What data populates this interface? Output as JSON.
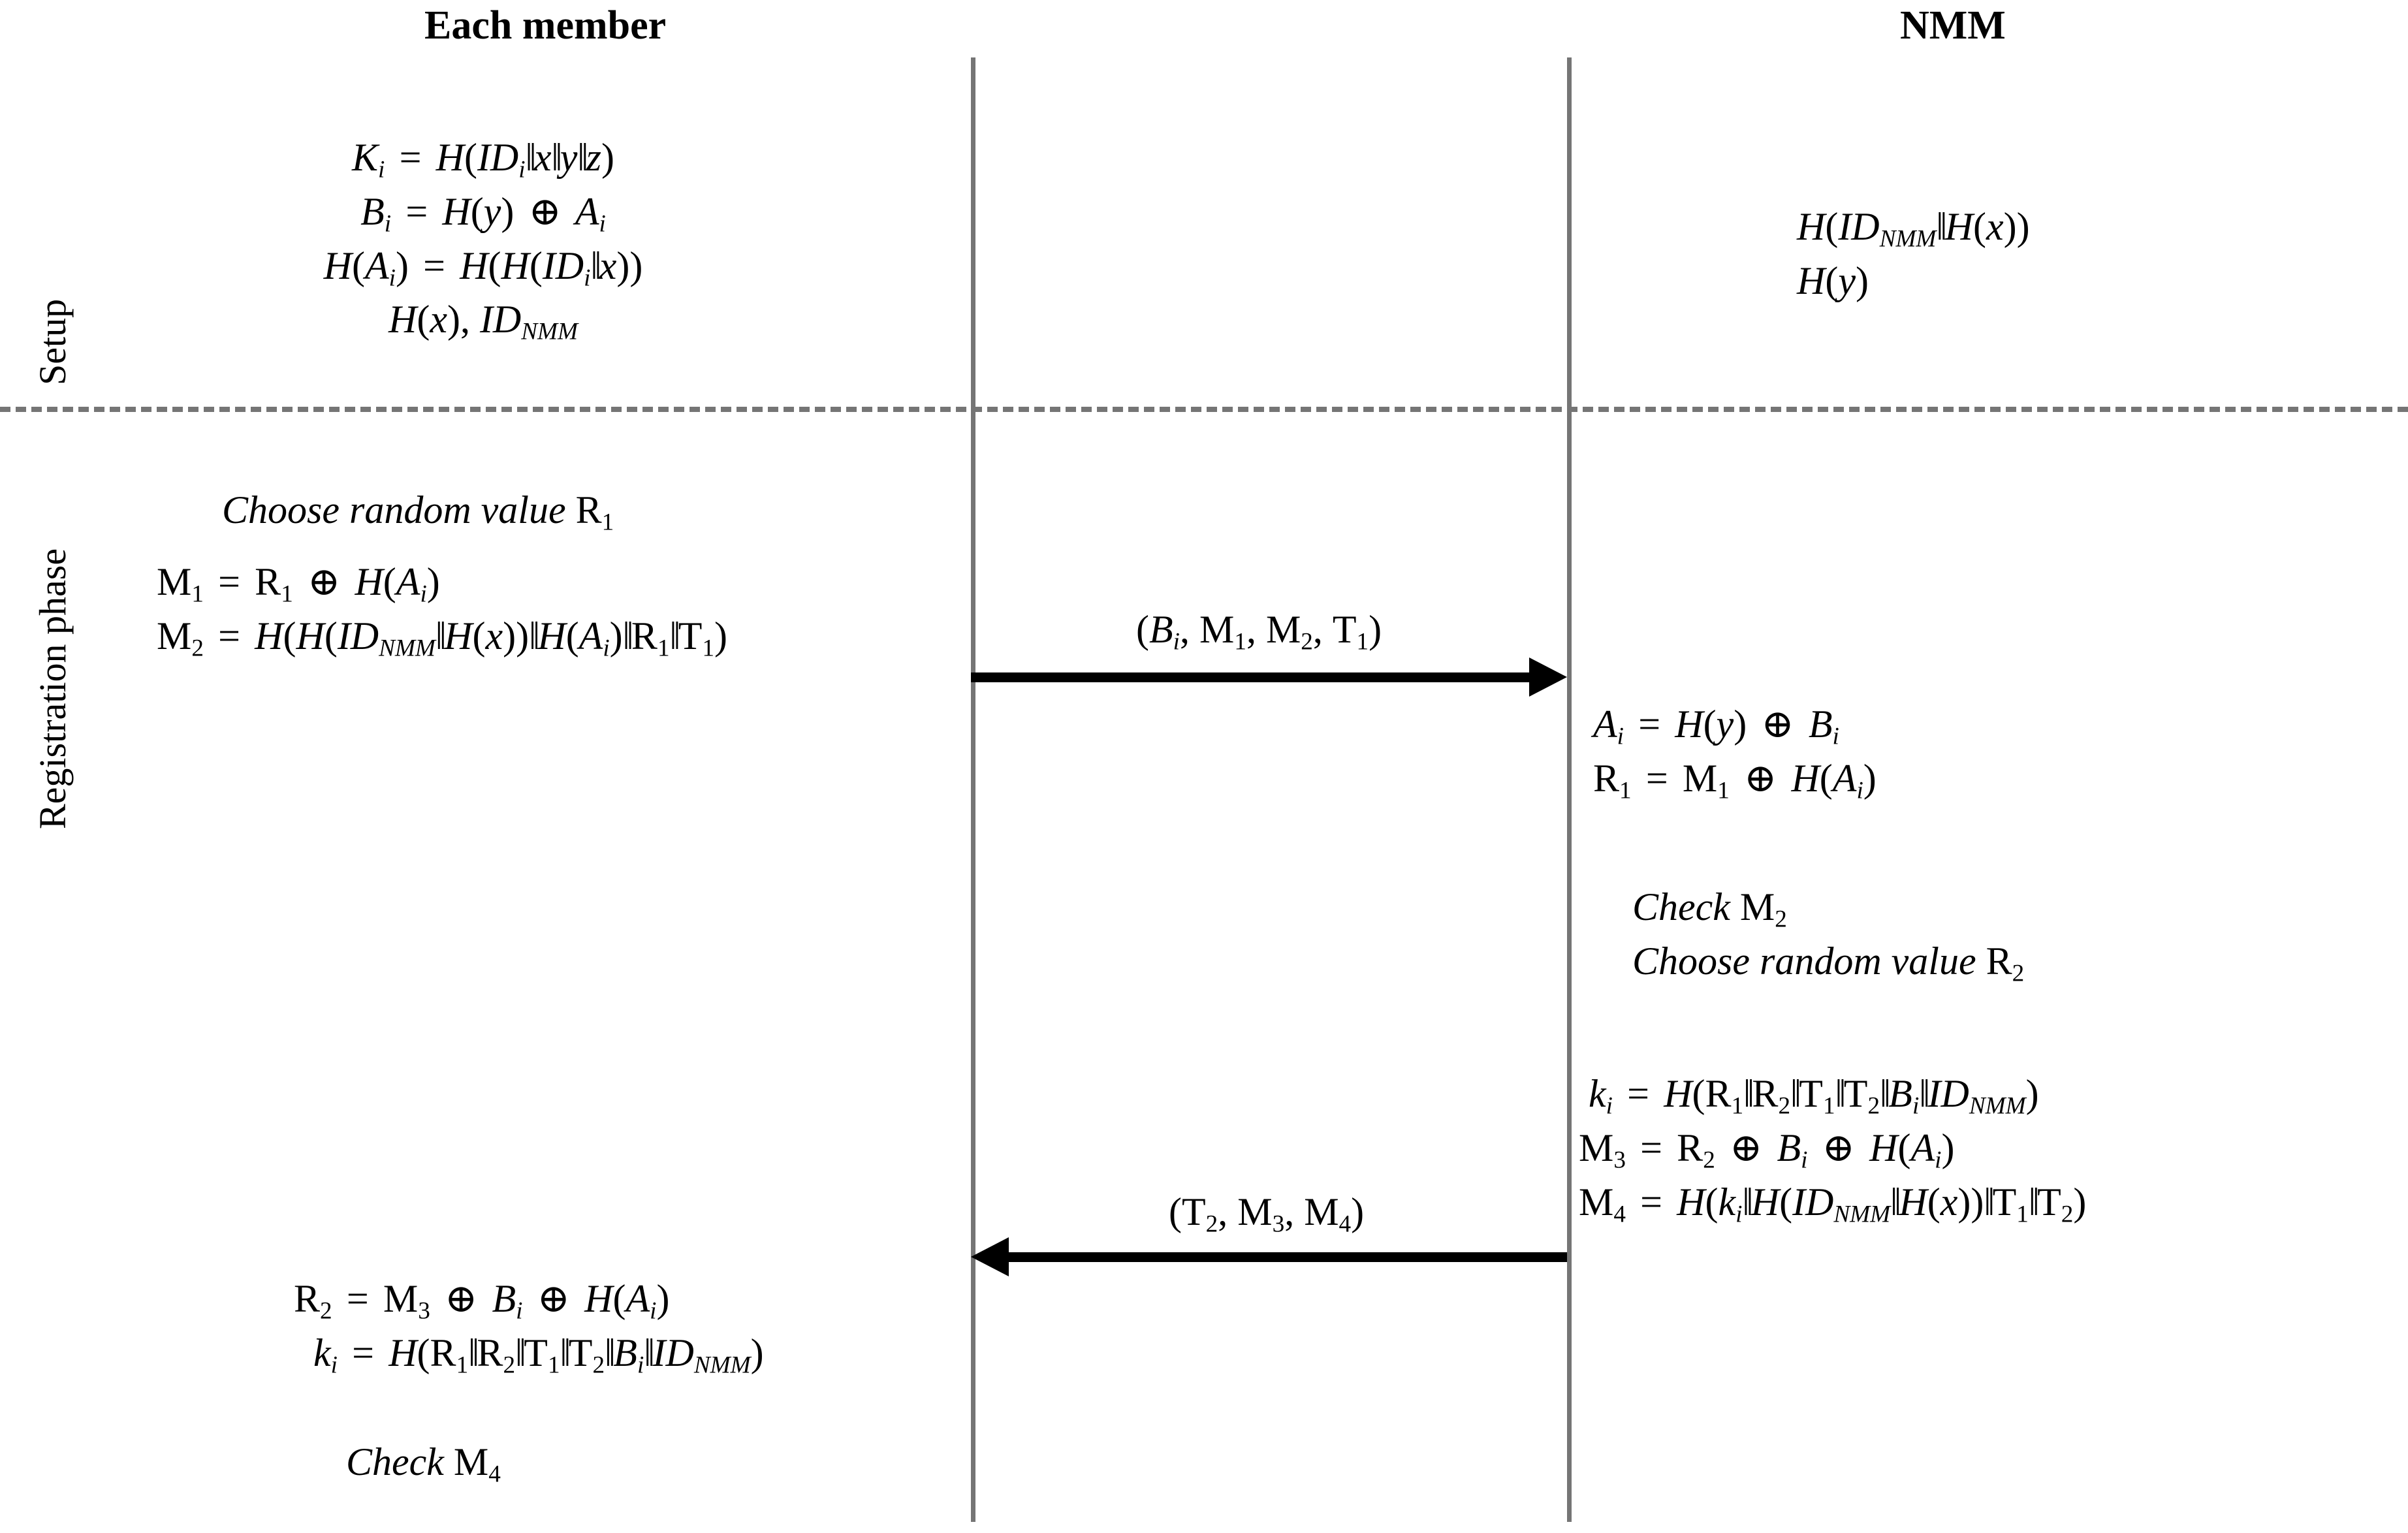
{
  "headers": {
    "left": "Each member",
    "right": "NMM"
  },
  "phases": [
    {
      "id": "setup",
      "label": "Setup"
    },
    {
      "id": "registration",
      "label": "Registration phase"
    }
  ],
  "setup": {
    "member_lines": [
      "K_i = H(ID_i‖x‖y‖z)",
      "B_i = H(y) ⊕ A_i",
      "H(A_i) = H(H(ID_i‖x))",
      "H(x), ID_NMM"
    ],
    "nmm_lines": [
      "H(ID_NMM‖H(x))",
      "H(y)"
    ]
  },
  "registration": {
    "member_pre": [
      "Choose random value R_1",
      "M_1 = R_1 ⊕ H(A_i)",
      "M_2 = H(H(ID_NMM‖H(x))‖H(A_i)‖R_1‖T_1)"
    ],
    "nmm_recv": [
      "A_i = H(y) ⊕ B_i",
      "R_1 = M_1 ⊕ H(A_i)"
    ],
    "nmm_check": [
      "Check M_2",
      "Choose random value R_2"
    ],
    "nmm_compute": [
      "k_i = H(R_1‖R_2‖T_1‖T_2‖B_i‖ID_NMM)",
      "M_3 = R_2 ⊕ B_i ⊕ H(A_i)",
      "M_4 = H(k_i‖H(ID_NMM‖H(x))‖T_1‖T_2)"
    ],
    "member_post": [
      "R_2 = M_3 ⊕ B_i ⊕ H(A_i)",
      "k_i = H(R_1‖R_2‖T_1‖T_2‖B_i‖ID_NMM)"
    ],
    "member_final": "Check M_4"
  },
  "messages": [
    {
      "id": "msg1",
      "label": "(B_i, M_1, M_2, T_1)",
      "direction": "right"
    },
    {
      "id": "msg2",
      "label": "(T_2, M_3, M_4)",
      "direction": "left"
    }
  ],
  "colors": {
    "lifeline": "#757575",
    "divider": "#757575",
    "arrow": "#000000",
    "text": "#000000",
    "background": "#ffffff"
  }
}
